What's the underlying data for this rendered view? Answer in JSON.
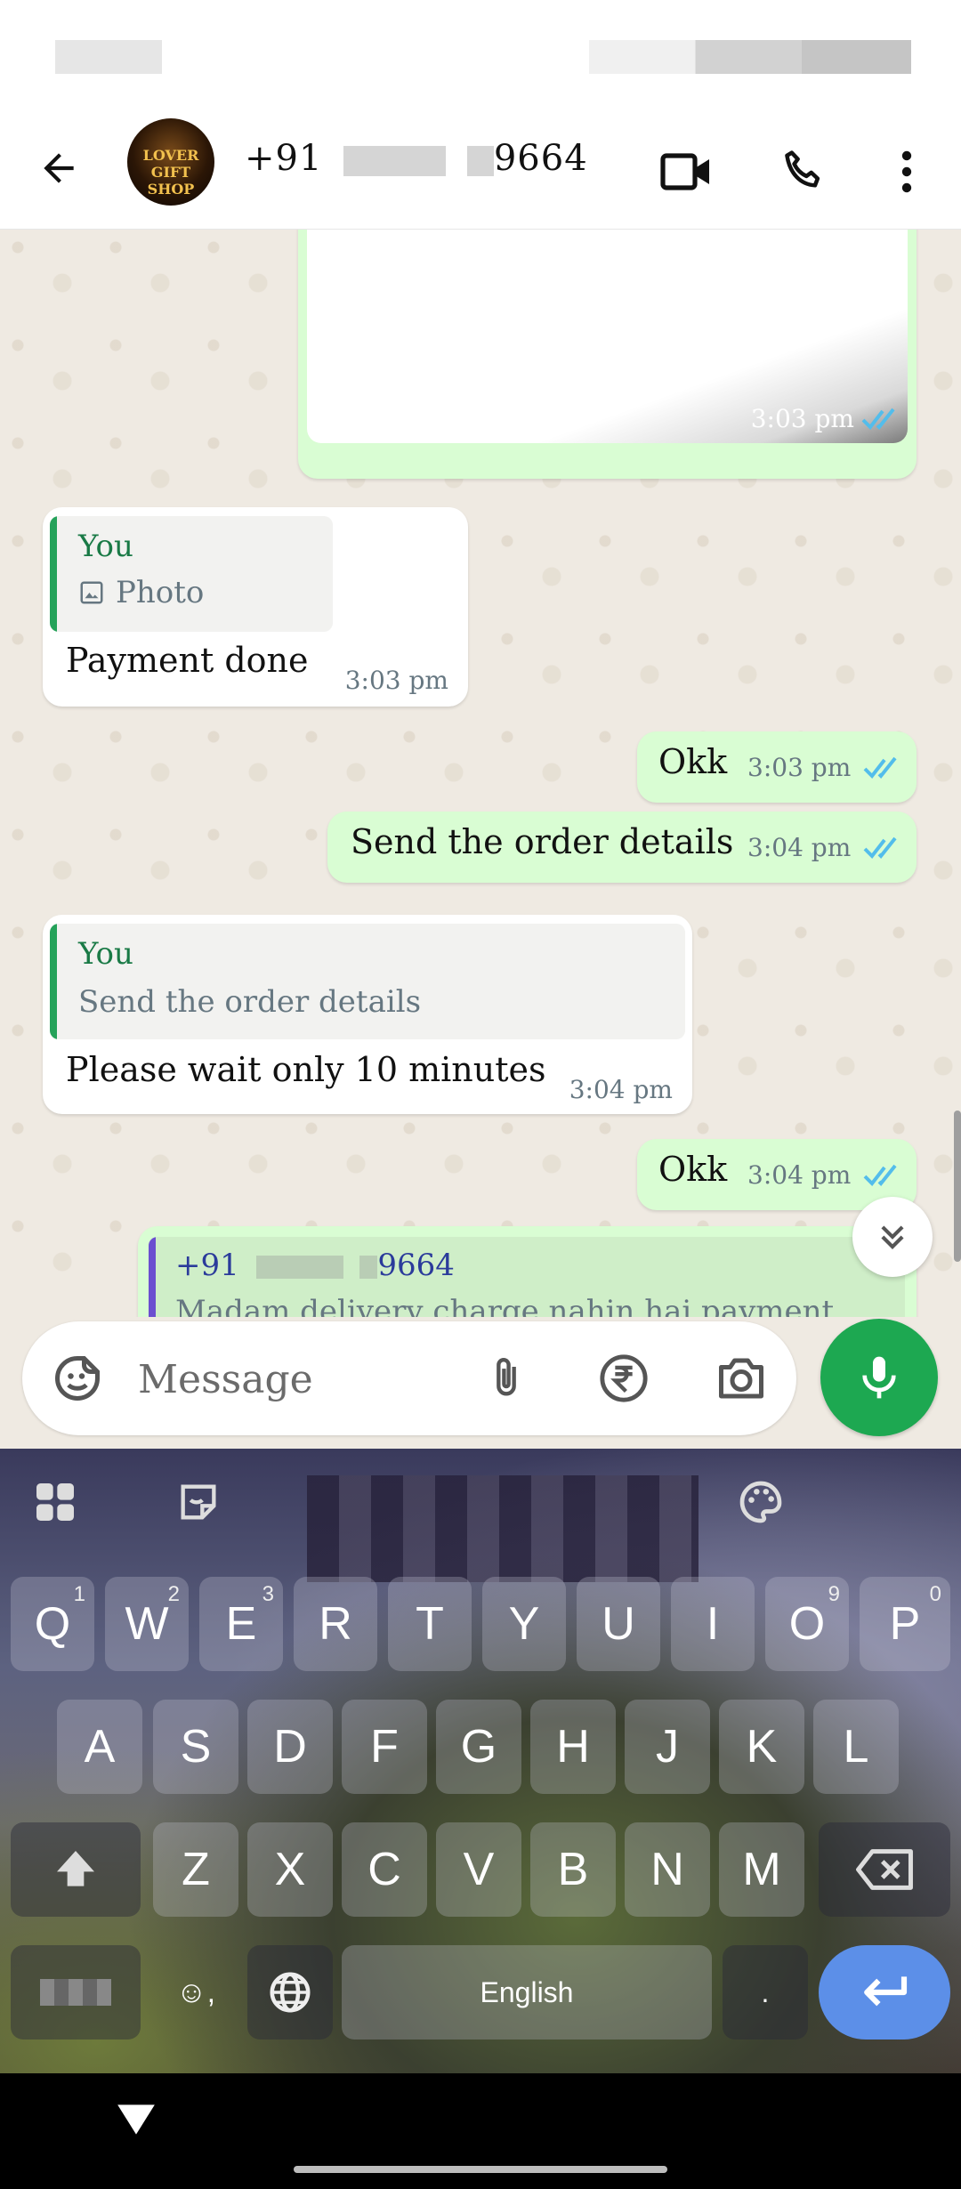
{
  "header": {
    "avatar_text": "LOVER\nGIFT SHOP",
    "contact_prefix": "+91",
    "contact_suffix": "9664"
  },
  "messages": {
    "m0_time": "3:03 pm",
    "m1_quote_author": "You",
    "m1_quote_text": "Photo",
    "m1_text": "Payment done",
    "m1_time": "3:03 pm",
    "m2_text": "Okk",
    "m2_time": "3:03 pm",
    "m3_text": "Send the order details",
    "m3_time": "3:04 pm",
    "m4_quote_author": "You",
    "m4_quote_text": "Send the order details",
    "m4_text": "Please wait only 10 minutes",
    "m4_time": "3:04 pm",
    "m5_text": "Okk",
    "m5_time": "3:04 pm",
    "m6_quote_prefix": "+91",
    "m6_quote_suffix": "9664",
    "m6_text": "Madam delivery charge nahin hai payment"
  },
  "composer": {
    "placeholder": "Message"
  },
  "keyboard": {
    "row1": [
      [
        "Q",
        "1"
      ],
      [
        "W",
        "2"
      ],
      [
        "E",
        "3"
      ],
      [
        "R",
        ""
      ],
      [
        "T",
        ""
      ],
      [
        "Y",
        ""
      ],
      [
        "U",
        ""
      ],
      [
        "I",
        ""
      ],
      [
        "O",
        "9"
      ],
      [
        "P",
        "0"
      ]
    ],
    "row2": [
      "A",
      "S",
      "D",
      "F",
      "G",
      "H",
      "J",
      "K",
      "L"
    ],
    "row3": [
      "Z",
      "X",
      "C",
      "V",
      "B",
      "N",
      "M"
    ],
    "space_label": "English",
    "period": "."
  },
  "colors": {
    "accent_green": "#1da851",
    "tick_blue": "#53bdeb",
    "outgoing_bubble": "#d9fdd3"
  }
}
